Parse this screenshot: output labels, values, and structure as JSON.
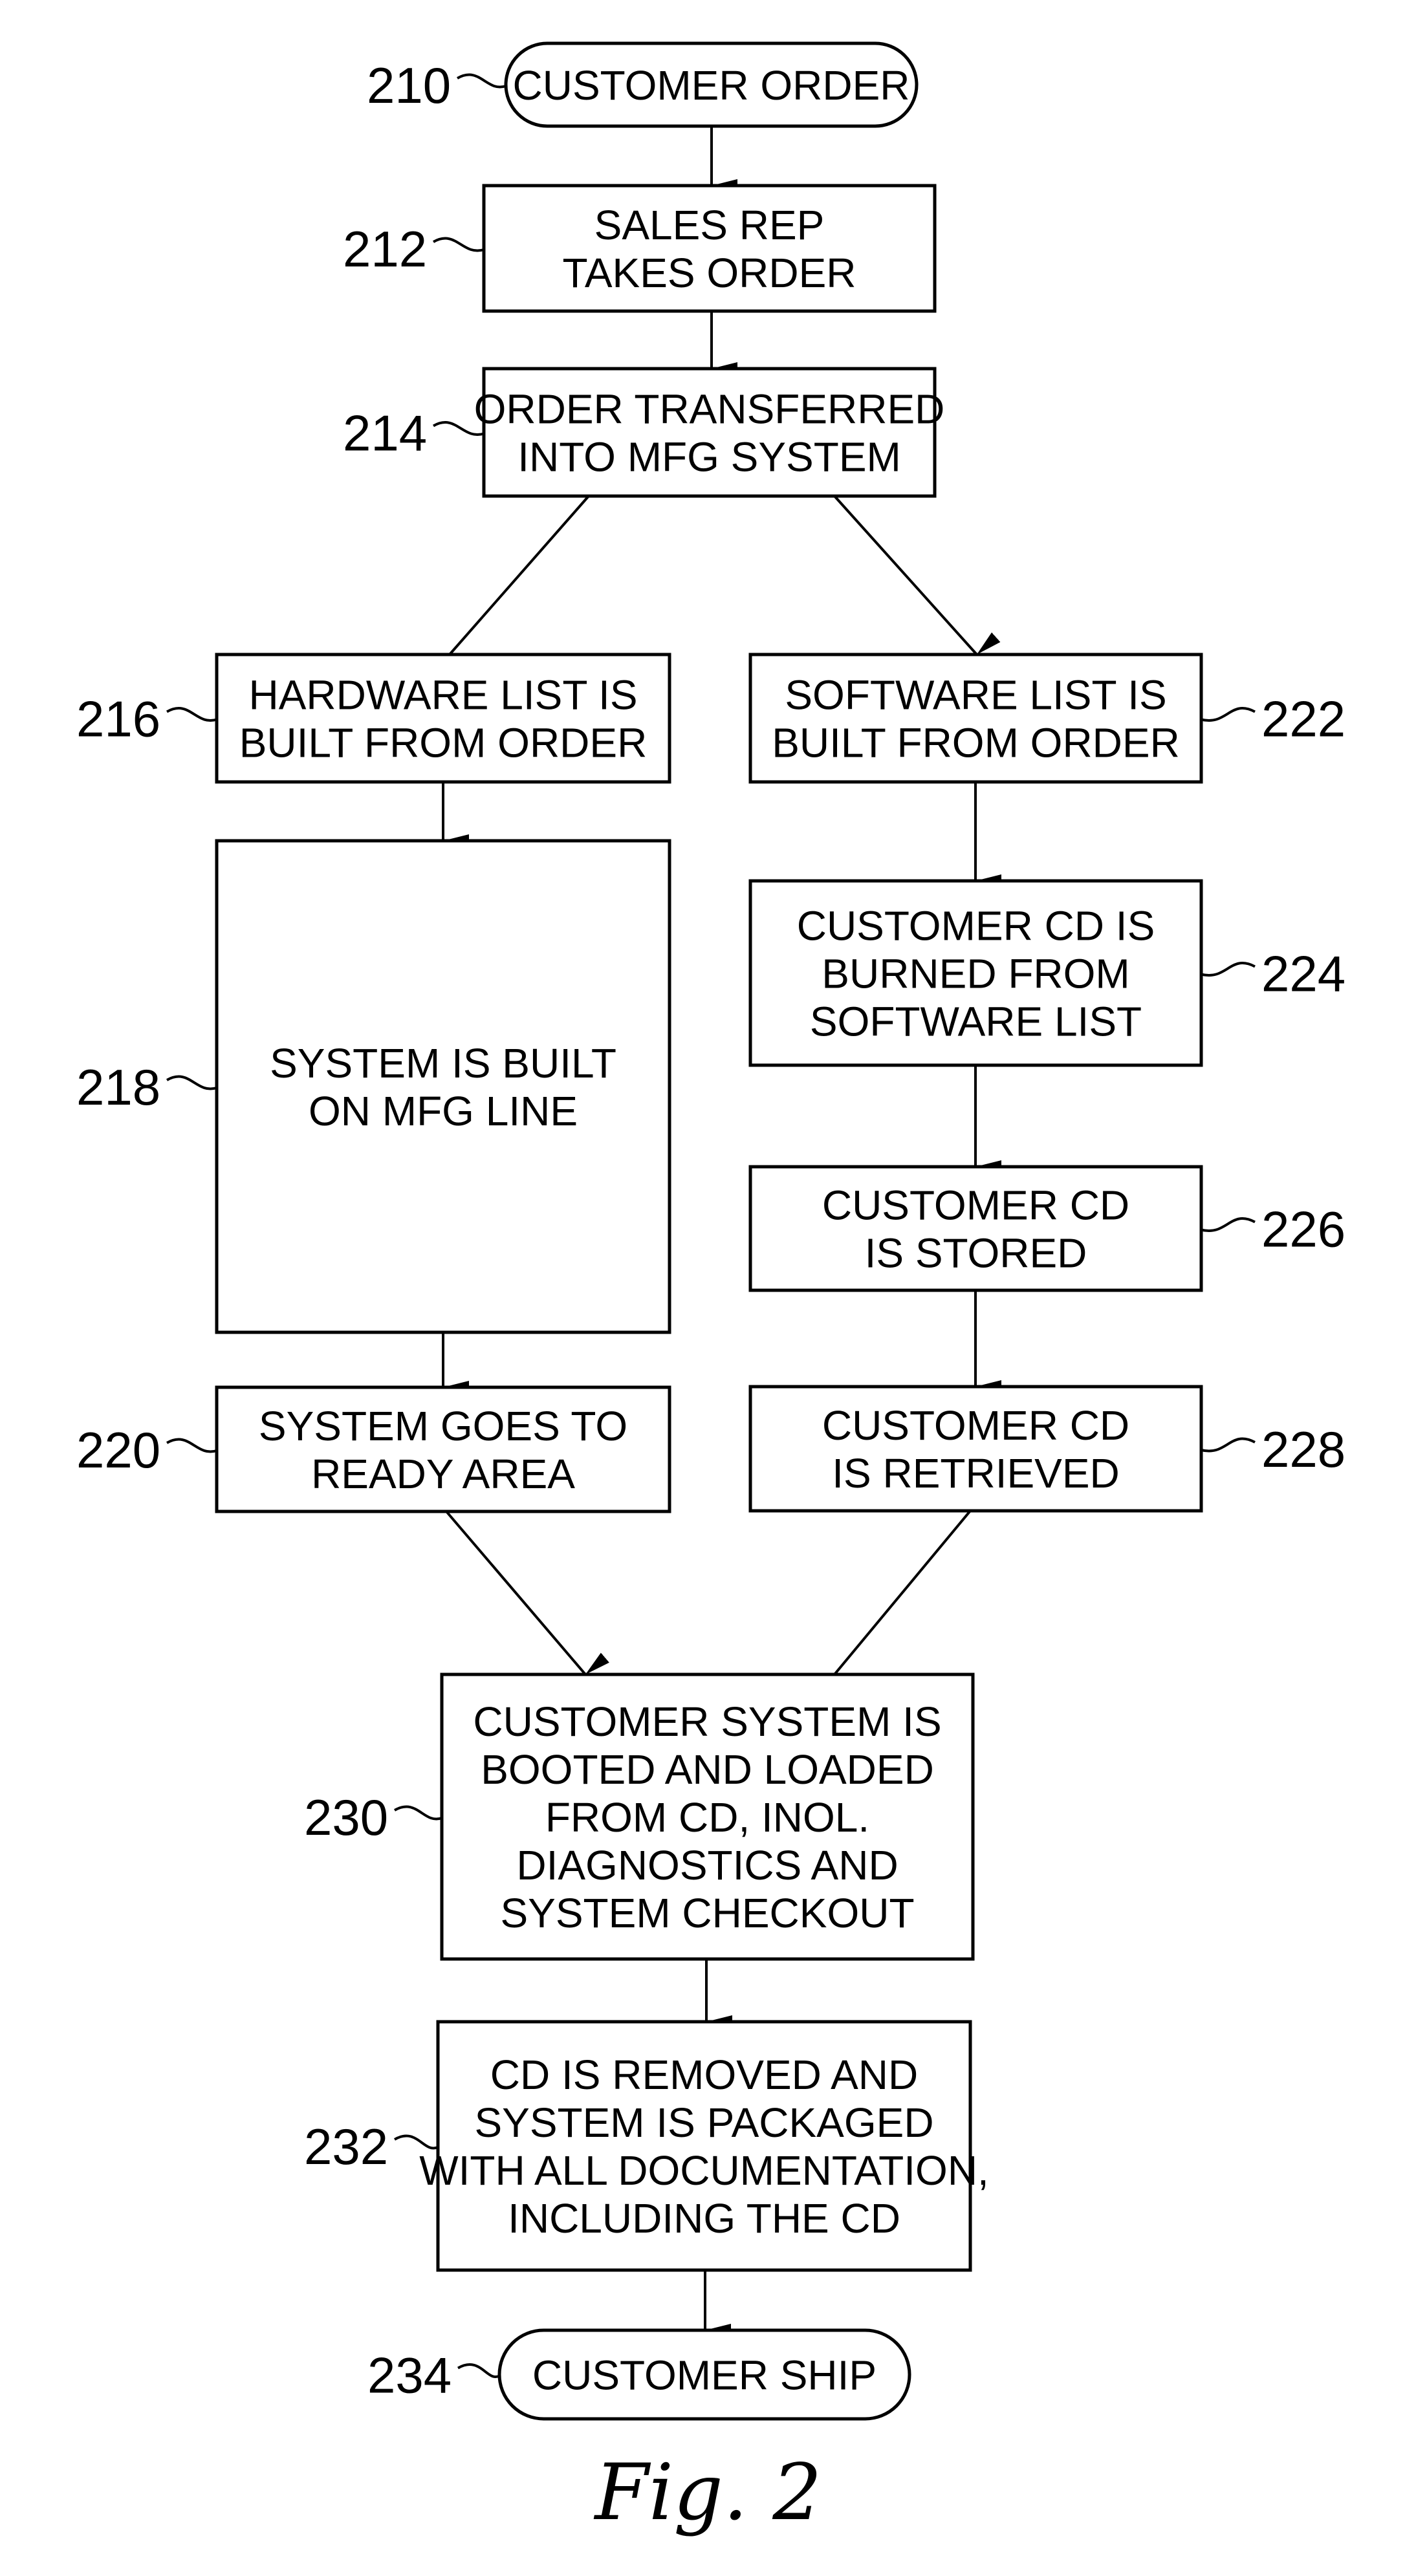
{
  "figure": {
    "caption": "Fig. 2",
    "nodes": [
      {
        "id": "210",
        "ref": "210",
        "shape": "terminal",
        "lines": [
          "CUSTOMER ORDER"
        ]
      },
      {
        "id": "212",
        "ref": "212",
        "shape": "process",
        "lines": [
          "SALES REP",
          "TAKES ORDER"
        ]
      },
      {
        "id": "214",
        "ref": "214",
        "shape": "process",
        "lines": [
          "ORDER TRANSFERRED",
          "INTO MFG SYSTEM"
        ]
      },
      {
        "id": "216",
        "ref": "216",
        "shape": "process",
        "lines": [
          "HARDWARE LIST IS",
          "BUILT FROM ORDER"
        ]
      },
      {
        "id": "218",
        "ref": "218",
        "shape": "process",
        "lines": [
          "SYSTEM IS BUILT",
          "ON MFG LINE"
        ]
      },
      {
        "id": "220",
        "ref": "220",
        "shape": "process",
        "lines": [
          "SYSTEM GOES TO",
          "READY AREA"
        ]
      },
      {
        "id": "222",
        "ref": "222",
        "shape": "process",
        "lines": [
          "SOFTWARE LIST IS",
          "BUILT FROM ORDER"
        ]
      },
      {
        "id": "224",
        "ref": "224",
        "shape": "process",
        "lines": [
          "CUSTOMER CD IS",
          "BURNED FROM",
          "SOFTWARE LIST"
        ]
      },
      {
        "id": "226",
        "ref": "226",
        "shape": "process",
        "lines": [
          "CUSTOMER CD",
          "IS STORED"
        ]
      },
      {
        "id": "228",
        "ref": "228",
        "shape": "process",
        "lines": [
          "CUSTOMER CD",
          "IS RETRIEVED"
        ]
      },
      {
        "id": "230",
        "ref": "230",
        "shape": "process",
        "lines": [
          "CUSTOMER SYSTEM IS",
          "BOOTED AND LOADED",
          "FROM CD, INOL.",
          "DIAGNOSTICS AND",
          "SYSTEM CHECKOUT"
        ]
      },
      {
        "id": "232",
        "ref": "232",
        "shape": "process",
        "lines": [
          "CD IS REMOVED AND",
          "SYSTEM IS PACKAGED",
          "WITH ALL DOCUMENTATION,",
          "INCLUDING THE CD"
        ]
      },
      {
        "id": "234",
        "ref": "234",
        "shape": "terminal",
        "lines": [
          "CUSTOMER SHIP"
        ]
      }
    ],
    "edges": [
      {
        "from": "210",
        "to": "212"
      },
      {
        "from": "212",
        "to": "214"
      },
      {
        "from": "214",
        "to": "216"
      },
      {
        "from": "214",
        "to": "222"
      },
      {
        "from": "216",
        "to": "218"
      },
      {
        "from": "218",
        "to": "220"
      },
      {
        "from": "222",
        "to": "224"
      },
      {
        "from": "224",
        "to": "226"
      },
      {
        "from": "226",
        "to": "228"
      },
      {
        "from": "220",
        "to": "230"
      },
      {
        "from": "228",
        "to": "230"
      },
      {
        "from": "230",
        "to": "232"
      },
      {
        "from": "232",
        "to": "234"
      }
    ]
  }
}
